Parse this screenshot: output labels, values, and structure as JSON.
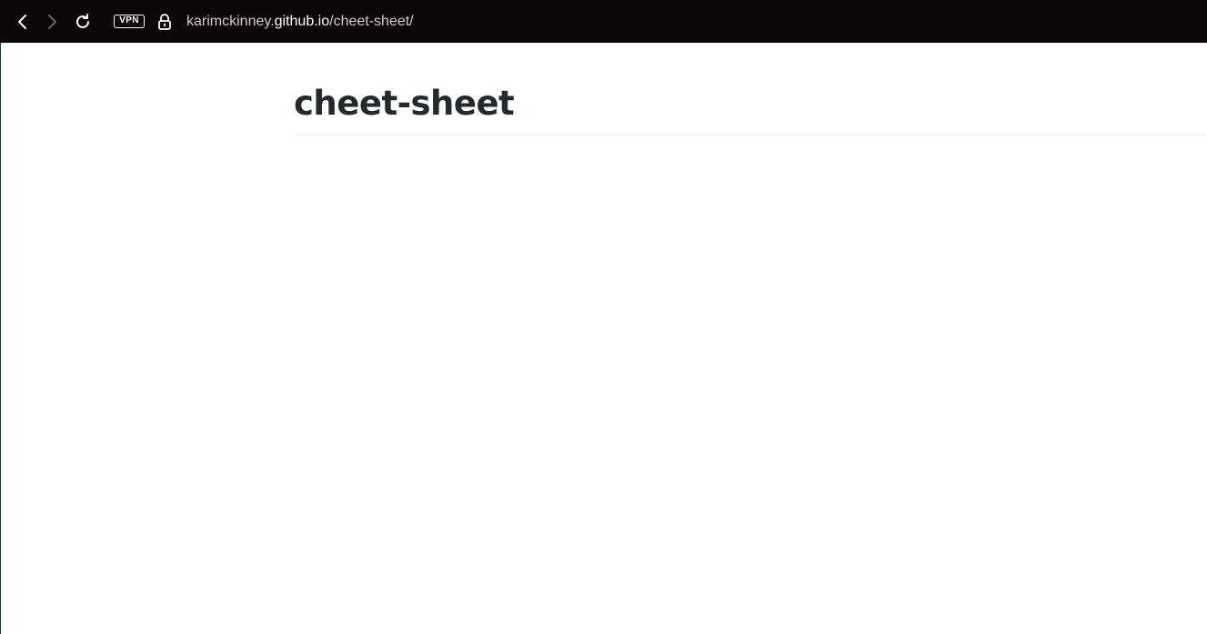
{
  "browser": {
    "vpn_label": "VPN",
    "url": {
      "prefix": "karimckinney.",
      "domain": "github.io",
      "path": "/cheet-sheet/"
    },
    "icons": {
      "back": "chevron-left-icon",
      "forward": "chevron-right-icon",
      "reload": "reload-icon",
      "lock": "lock-icon"
    }
  },
  "page": {
    "title": "cheet-sheet"
  },
  "colors": {
    "toolbar_bg": "#0c0606",
    "title_text": "#24292e",
    "rule": "#eaecef"
  }
}
